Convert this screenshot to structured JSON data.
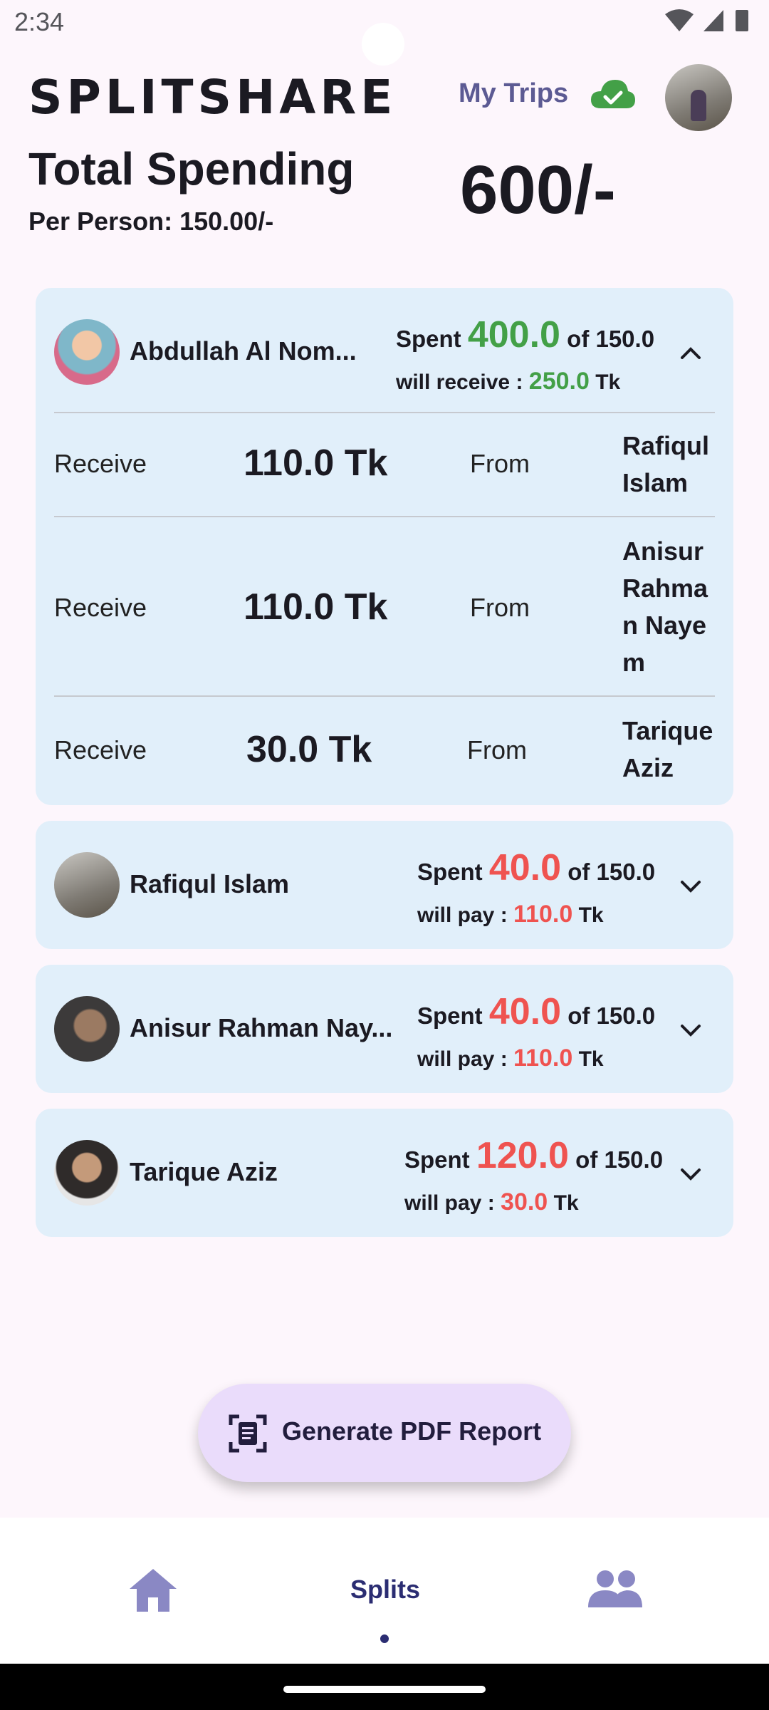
{
  "status": {
    "time": "2:34"
  },
  "header": {
    "logo": "SPLITSHARE",
    "my_trips": "My Trips"
  },
  "summary": {
    "title": "Total Spending",
    "per_person": "Per Person: 150.00/-",
    "total": "600/-"
  },
  "members": [
    {
      "name": "Abdullah Al Nom...",
      "spent_label": "Spent",
      "spent": "400.0",
      "of": "of 150.0",
      "status_label": "will receive : ",
      "balance": "250.0",
      "unit": "Tk",
      "expanded": true,
      "transactions": [
        {
          "label": "Receive",
          "amount": "110.0 Tk",
          "from": "From",
          "who": "Rafiqul Islam"
        },
        {
          "label": "Receive",
          "amount": "110.0 Tk",
          "from": "From",
          "who": "Anisur Rahman Nayem"
        },
        {
          "label": "Receive",
          "amount": "30.0 Tk",
          "from": "From",
          "who": "Tarique Aziz"
        }
      ]
    },
    {
      "name": "Rafiqul Islam",
      "spent_label": "Spent",
      "spent": "40.0",
      "of": "of 150.0",
      "status_label": "will pay : ",
      "balance": "110.0",
      "unit": "Tk",
      "expanded": false
    },
    {
      "name": "Anisur Rahman Nay...",
      "spent_label": "Spent",
      "spent": "40.0",
      "of": "of 150.0",
      "status_label": "will pay : ",
      "balance": "110.0",
      "unit": "Tk",
      "expanded": false
    },
    {
      "name": "Tarique Aziz",
      "spent_label": "Spent",
      "spent": "120.0",
      "of": "of 150.0",
      "status_label": "will pay : ",
      "balance": "30.0",
      "unit": "Tk",
      "expanded": false
    }
  ],
  "pdf_button": {
    "label": "Generate PDF Report"
  },
  "nav": {
    "splits": "Splits",
    "home_icon": "home-icon",
    "people_icon": "group-icon"
  },
  "colors": {
    "positive": "#43a047",
    "negative": "#ef5350",
    "card": "#e1effa",
    "accent": "#2b2d72"
  }
}
